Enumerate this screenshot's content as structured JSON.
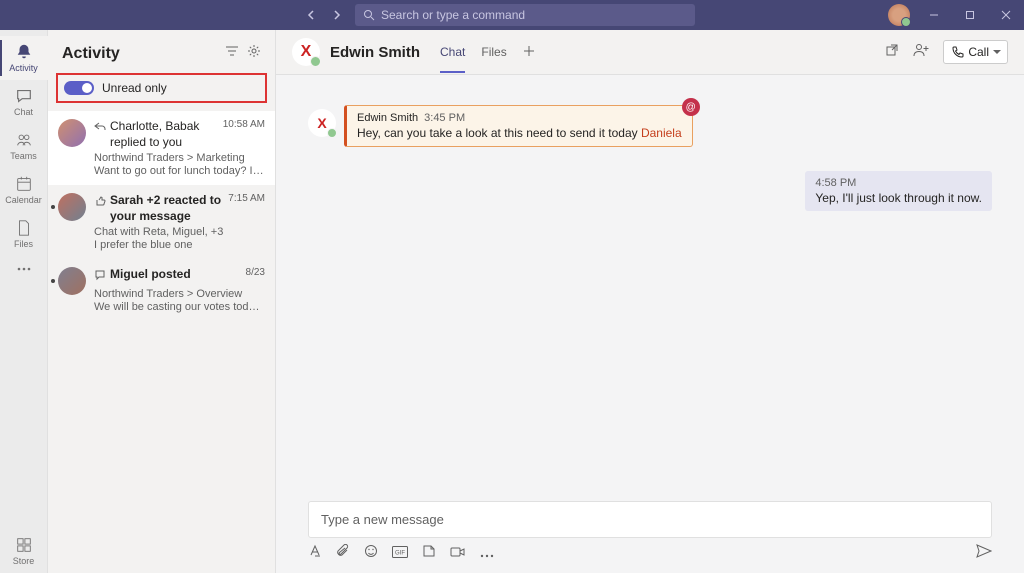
{
  "titlebar": {
    "search_placeholder": "Search or type a command"
  },
  "rail": {
    "activity": "Activity",
    "chat": "Chat",
    "teams": "Teams",
    "calendar": "Calendar",
    "files": "Files",
    "store": "Store"
  },
  "panel": {
    "title": "Activity",
    "unread_label": "Unread only",
    "items": [
      {
        "title": "Charlotte, Babak replied to you",
        "time": "10:58 AM",
        "meta": "Northwind Traders > Marketing",
        "preview": "Want to go out for lunch today? It's my..."
      },
      {
        "title": "Sarah +2 reacted to your message",
        "time": "7:15 AM",
        "meta": "Chat with Reta, Miguel, +3",
        "preview": "I prefer the blue one"
      },
      {
        "title": "Miguel posted",
        "time": "8/23",
        "meta": "Northwind Traders > Overview",
        "preview": "We will be casting our votes today, every..."
      }
    ]
  },
  "chat": {
    "name": "Edwin Smith",
    "avatar_letter": "X",
    "tabs": {
      "chat": "Chat",
      "files": "Files"
    },
    "call_label": "Call",
    "messages": {
      "in": {
        "sender": "Edwin Smith",
        "time": "3:45 PM",
        "text": "Hey, can you take a look at this need to send it today ",
        "mention": "Daniela"
      },
      "out": {
        "time": "4:58 PM",
        "text": "Yep, I'll just look through it now."
      }
    }
  },
  "compose": {
    "placeholder": "Type a new message"
  }
}
